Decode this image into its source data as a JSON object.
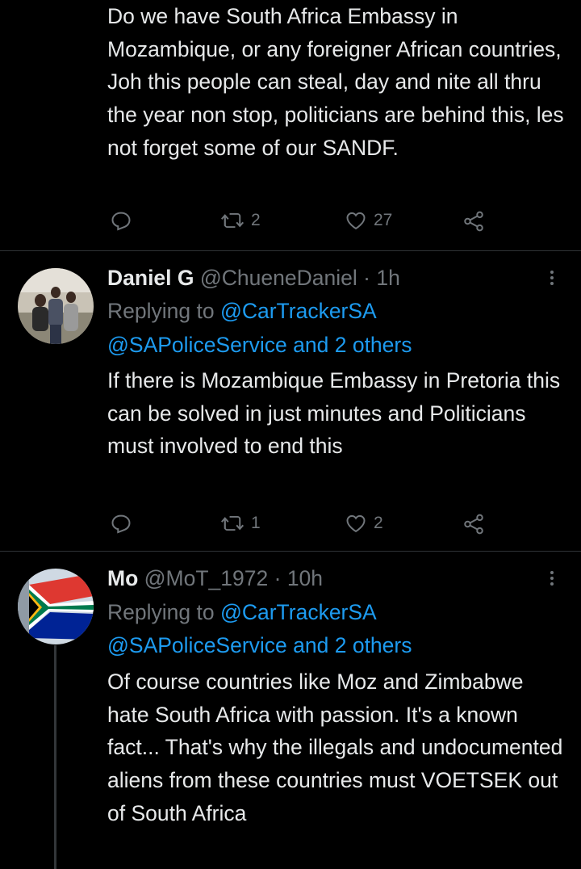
{
  "tweets": [
    {
      "body": "Do we have South Africa Embassy in Mozambique, or any foreigner African countries, Joh this people can steal, day and nite all thru the year non stop, politicians are behind this, les not forget some of our SANDF.",
      "actions": {
        "reply": "",
        "retweets": "2",
        "likes": "27"
      }
    },
    {
      "name": "Daniel G",
      "handle": "@ChueneDaniel",
      "sep": "·",
      "time": "1h",
      "replying_label": "Replying to",
      "replying_to": "@CarTrackerSA",
      "replying_more": "@SAPoliceService and 2 others",
      "body": "If there is Mozambique Embassy in Pretoria this can be solved in just minutes and Politicians must involved to end this",
      "actions": {
        "reply": "",
        "retweets": "1",
        "likes": "2"
      }
    },
    {
      "name": "Mo",
      "handle": "@MoT_1972",
      "sep": "·",
      "time": "10h",
      "replying_label": "Replying to",
      "replying_to": "@CarTrackerSA",
      "replying_more": "@SAPoliceService and 2 others",
      "body": "Of course countries like Moz and Zimbabwe hate South Africa with passion. It's a known fact... That's why the illegals and undocumented aliens from these countries must VOETSEK out of South Africa"
    }
  ],
  "colors": {
    "background": "#000000",
    "text": "#e7e9ea",
    "muted": "#71767b",
    "link": "#1d9bf0",
    "divider": "#2f3336"
  },
  "icons": [
    "reply-icon",
    "retweet-icon",
    "like-icon",
    "share-icon",
    "more-icon"
  ]
}
